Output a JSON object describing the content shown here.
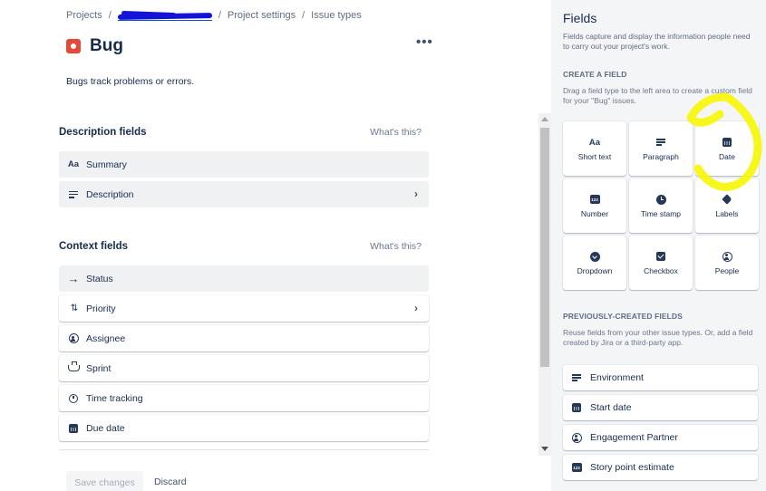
{
  "breadcrumb": {
    "projects": "Projects",
    "project_settings": "Project settings",
    "issue_types": "Issue types"
  },
  "issue_type": {
    "name": "Bug",
    "description": "Bugs track problems or errors.",
    "icon": "bug-icon",
    "icon_color": "#e5493a"
  },
  "description_fields": {
    "heading": "Description fields",
    "help": "What's this?",
    "items": [
      {
        "label": "Summary",
        "icon": "short-text-icon"
      },
      {
        "label": "Description",
        "icon": "paragraph-icon"
      }
    ]
  },
  "context_fields": {
    "heading": "Context fields",
    "help": "What's this?",
    "items": [
      {
        "label": "Status",
        "icon": "arrow-right-icon"
      },
      {
        "label": "Priority",
        "icon": "priority-icon"
      },
      {
        "label": "Assignee",
        "icon": "person-icon"
      },
      {
        "label": "Sprint",
        "icon": "sprint-icon"
      },
      {
        "label": "Time tracking",
        "icon": "stopwatch-icon"
      },
      {
        "label": "Due date",
        "icon": "calendar-icon"
      }
    ]
  },
  "actions": {
    "save": "Save changes",
    "discard": "Discard"
  },
  "panel": {
    "title": "Fields",
    "description": "Fields capture and display the information people need to carry out your project's work.",
    "create_caption": "CREATE A FIELD",
    "create_help": "Drag a field type to the left area to create a custom field for your \"Bug\" issues.",
    "field_types": [
      {
        "label": "Short text",
        "icon": "short-text-icon"
      },
      {
        "label": "Paragraph",
        "icon": "paragraph-icon"
      },
      {
        "label": "Date",
        "icon": "calendar-icon"
      },
      {
        "label": "Number",
        "icon": "number-icon",
        "glyph": "123"
      },
      {
        "label": "Time stamp",
        "icon": "clock-icon"
      },
      {
        "label": "Labels",
        "icon": "tag-icon"
      },
      {
        "label": "Dropdown",
        "icon": "dropdown-icon"
      },
      {
        "label": "Checkbox",
        "icon": "checkbox-icon"
      },
      {
        "label": "People",
        "icon": "person-icon"
      }
    ],
    "previous_caption": "PREVIOUSLY-CREATED FIELDS",
    "previous_help": "Reuse fields from your other issue types. Or, add a field created by Jira or a third-party app.",
    "previous_fields": [
      {
        "label": "Environment",
        "icon": "paragraph-icon"
      },
      {
        "label": "Start date",
        "icon": "calendar-icon"
      },
      {
        "label": "Engagement Partner",
        "icon": "person-icon"
      },
      {
        "label": "Story point estimate",
        "icon": "number-icon",
        "glyph": "123"
      }
    ]
  },
  "glyphs": {
    "aa": "Aa",
    "more": "•••",
    "chevron": "›",
    "arrow_right": "→",
    "updown": "⇅"
  },
  "colors": {
    "panel_bg": "#f4f5f7",
    "row_grey": "#f0f1f3",
    "annotation": "#f6f60a",
    "redaction": "#1414d9"
  }
}
